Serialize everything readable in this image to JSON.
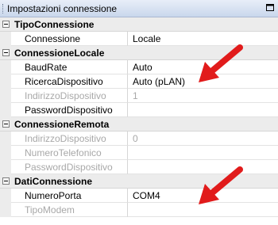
{
  "window": {
    "title": "Impostazioni connessione"
  },
  "categories": [
    {
      "label": "TipoConnessione",
      "props": [
        {
          "name": "Connessione",
          "value": "Locale",
          "enabled": true
        }
      ]
    },
    {
      "label": "ConnessioneLocale",
      "props": [
        {
          "name": "BaudRate",
          "value": "Auto",
          "enabled": true
        },
        {
          "name": "RicercaDispositivo",
          "value": "Auto (pLAN)",
          "enabled": true
        },
        {
          "name": "IndirizzoDispositivo",
          "value": "1",
          "enabled": false
        },
        {
          "name": "PasswordDispositivo",
          "value": "",
          "enabled": true
        }
      ]
    },
    {
      "label": "ConnessioneRemota",
      "props": [
        {
          "name": "IndirizzoDispositivo",
          "value": "0",
          "enabled": false
        },
        {
          "name": "NumeroTelefonico",
          "value": "",
          "enabled": false
        },
        {
          "name": "PasswordDispositivo",
          "value": "",
          "enabled": false
        }
      ]
    },
    {
      "label": "DatiConnessione",
      "props": [
        {
          "name": "NumeroPorta",
          "value": "COM4",
          "enabled": true
        },
        {
          "name": "TipoModem",
          "value": "",
          "enabled": false
        }
      ]
    }
  ],
  "colors": {
    "annotation_arrow": "#e11b1b",
    "disabled_text": "#a8a8a8",
    "category_bg": "#ececec"
  },
  "icons": {
    "pin": "pin-icon",
    "toggle": "minus-box-icon",
    "annotation": "red-arrow-icon"
  }
}
